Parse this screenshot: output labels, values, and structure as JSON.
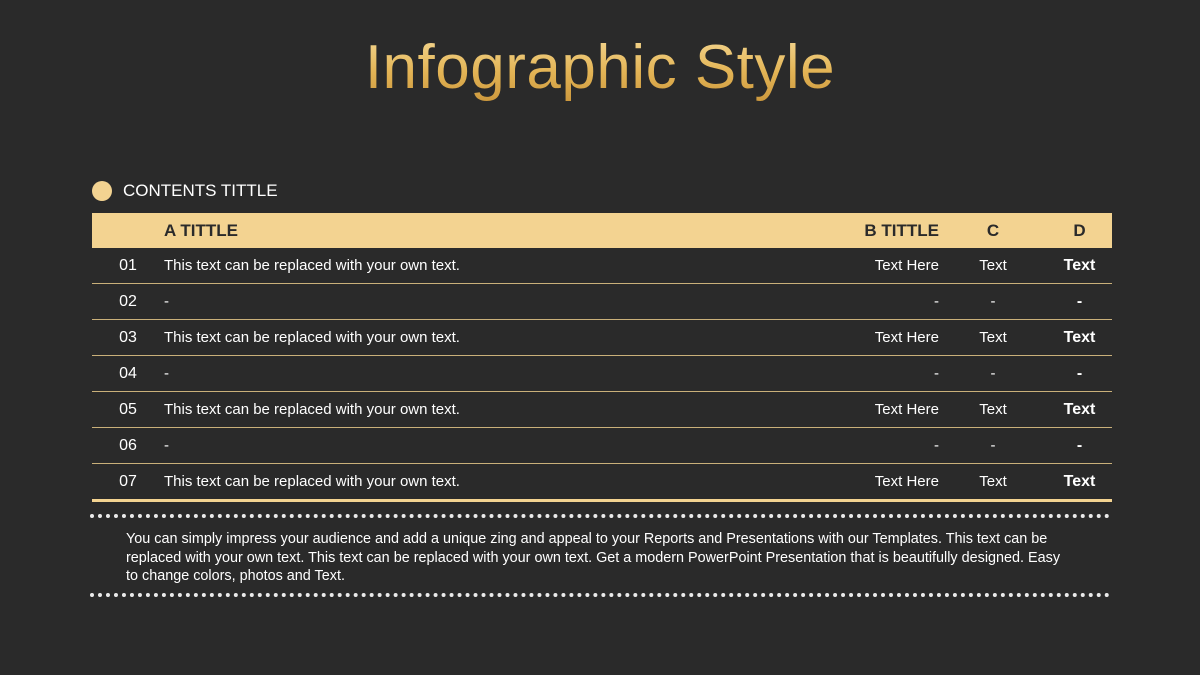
{
  "slide": {
    "title": "Infographic Style"
  },
  "section": {
    "title": "CONTENTS TITTLE",
    "dot_color": "#f3d391"
  },
  "table": {
    "headers": {
      "num": "",
      "a": "A TITTLE",
      "b": "B TITTLE",
      "c": "C",
      "d": "D"
    },
    "rows": [
      {
        "num": "01",
        "a": "This text can be replaced with your own text.",
        "b": "Text Here",
        "c": "Text",
        "d": "Text"
      },
      {
        "num": "02",
        "a": "-",
        "b": "-",
        "c": "-",
        "d": "-"
      },
      {
        "num": "03",
        "a": "This text can be replaced with your own text.",
        "b": "Text Here",
        "c": "Text",
        "d": "Text"
      },
      {
        "num": "04",
        "a": "-",
        "b": "-",
        "c": "-",
        "d": "-"
      },
      {
        "num": "05",
        "a": "This text can be replaced with your own text.",
        "b": "Text Here",
        "c": "Text",
        "d": "Text"
      },
      {
        "num": "06",
        "a": "-",
        "b": "-",
        "c": "-",
        "d": "-"
      },
      {
        "num": "07",
        "a": "This text can be replaced with your own text.",
        "b": "Text Here",
        "c": "Text",
        "d": "Text"
      }
    ]
  },
  "body": {
    "text": "You can simply impress your audience and add a unique zing and appeal to your Reports and Presentations with our Templates. This text can be replaced with your own text. This text can be replaced with your own text. Get a modern PowerPoint  Presentation that is beautifully designed. Easy to change colors, photos and Text."
  },
  "colors": {
    "background": "#2a2a2a",
    "accent": "#f3d391",
    "title_gold": "#e8bf63",
    "text": "#ffffff"
  }
}
